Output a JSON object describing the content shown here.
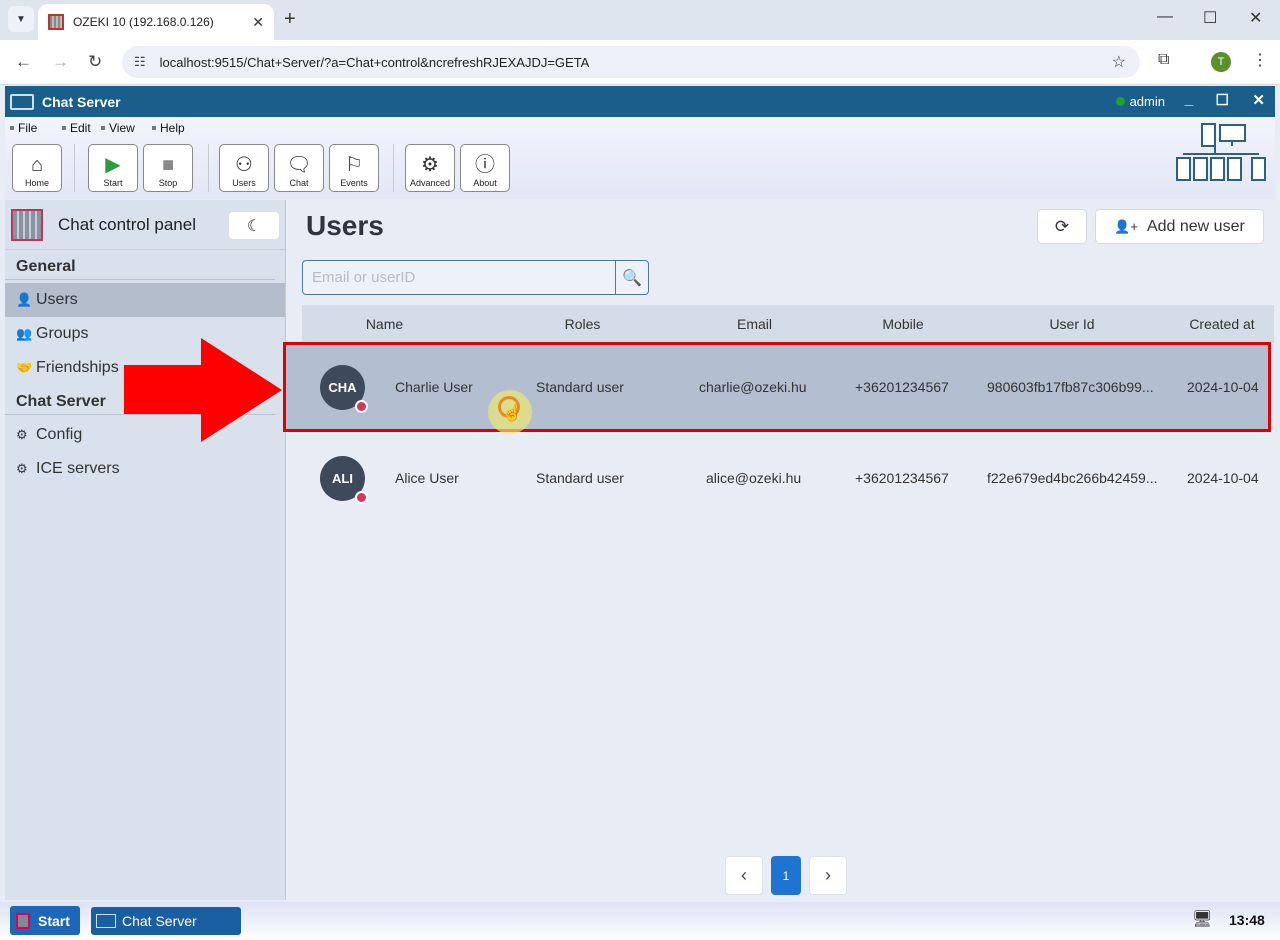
{
  "browser": {
    "tab_title": "OZEKI 10 (192.168.0.126)",
    "url": "localhost:9515/Chat+Server/?a=Chat+control&ncrefreshRJEXAJDJ=GETA",
    "profile_initial": "T"
  },
  "app": {
    "title": "Chat Server",
    "user": "admin",
    "menu": [
      "File",
      "Edit",
      "View",
      "Help"
    ],
    "toolbar": [
      {
        "label": "Home",
        "icon": "home-icon"
      },
      {
        "label": "Start",
        "icon": "play-icon"
      },
      {
        "label": "Stop",
        "icon": "stop-icon"
      },
      {
        "label": "Users",
        "icon": "users-icon"
      },
      {
        "label": "Chat",
        "icon": "chat-icon"
      },
      {
        "label": "Events",
        "icon": "flag-icon"
      },
      {
        "label": "Advanced",
        "icon": "gear-icon"
      },
      {
        "label": "About",
        "icon": "info-icon"
      }
    ]
  },
  "sidebar": {
    "title": "Chat control panel",
    "sections": [
      {
        "title": "General",
        "items": [
          {
            "label": "Users",
            "icon": "user-icon",
            "active": true
          },
          {
            "label": "Groups",
            "icon": "group-icon"
          },
          {
            "label": "Friendships",
            "icon": "handshake-icon"
          }
        ]
      },
      {
        "title": "Chat Server",
        "items": [
          {
            "label": "Config",
            "icon": "gears-icon"
          },
          {
            "label": "ICE servers",
            "icon": "gears-icon"
          }
        ]
      }
    ]
  },
  "main": {
    "title": "Users",
    "add_user_label": "Add new user",
    "search_placeholder": "Email or userID",
    "columns": [
      "Name",
      "Roles",
      "Email",
      "Mobile",
      "User Id",
      "Created at"
    ],
    "rows": [
      {
        "initials": "CHA",
        "name": "Charlie User",
        "role": "Standard user",
        "email": "charlie@ozeki.hu",
        "mobile": "+36201234567",
        "user_id": "980603fb17fb87c306b99...",
        "created": "2024-10-04",
        "selected": true
      },
      {
        "initials": "ALI",
        "name": "Alice User",
        "role": "Standard user",
        "email": "alice@ozeki.hu",
        "mobile": "+36201234567",
        "user_id": "f22e679ed4bc266b42459...",
        "created": "2024-10-04",
        "selected": false
      }
    ],
    "pagination": {
      "current": "1"
    }
  },
  "taskbar": {
    "start_label": "Start",
    "task_label": "Chat Server",
    "clock": "13:48"
  },
  "colors": {
    "title_bar": "#1a5f8c",
    "selection_border": "#e00000",
    "page_active": "#1f73d3",
    "status_dot": "#d9345a"
  }
}
